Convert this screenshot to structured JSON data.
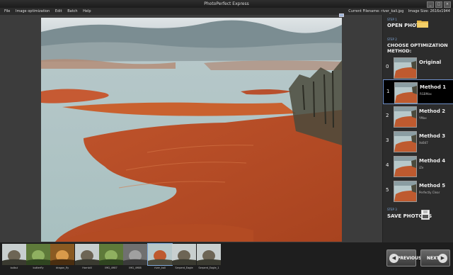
{
  "app": {
    "title": "PhotoPerfect Express",
    "window_controls": [
      "_",
      "□",
      "×"
    ]
  },
  "menu": {
    "items": [
      "File",
      "Image optimization",
      "Edit",
      "Batch",
      "Help"
    ],
    "current_filename": "Current Filename: river_kali.jpg",
    "image_size": "Image Size: 2616x1944"
  },
  "panel": {
    "step1": {
      "label": "STEP 1",
      "title": "OPEN PHOTO",
      "icon": "folder-icon"
    },
    "step2": {
      "label": "STEP 2",
      "title": "CHOOSE OPTIMIZATION METHOD:"
    },
    "methods": [
      {
        "num": "0",
        "name": "Original",
        "sub": ""
      },
      {
        "num": "1",
        "name": "Method 1",
        "sub": "RGBMax"
      },
      {
        "num": "2",
        "name": "Method 2",
        "sub": "YMax"
      },
      {
        "num": "3",
        "name": "Method 3",
        "sub": "XeB47"
      },
      {
        "num": "4",
        "name": "Method 4",
        "sub": "iZe"
      },
      {
        "num": "5",
        "name": "Method 5",
        "sub": "Perfectly Clear"
      }
    ],
    "selected_method": 1,
    "step3": {
      "label": "STEP 3",
      "title": "SAVE PHOTO AS",
      "icon": "save-icon"
    }
  },
  "filmstrip": [
    {
      "caption": "bulbul",
      "kind": "bird"
    },
    {
      "caption": "butterfly",
      "kind": "green"
    },
    {
      "caption": "dragon_fly",
      "kind": "orange"
    },
    {
      "caption": "Hornbill",
      "kind": "bird"
    },
    {
      "caption": "IMG_4987",
      "kind": "green"
    },
    {
      "caption": "IMG_4988",
      "kind": "grey"
    },
    {
      "caption": "river_kali",
      "kind": "river"
    },
    {
      "caption": "Serpent_Eagle",
      "kind": "bird"
    },
    {
      "caption": "Serpent_Eagle_1",
      "kind": "bird"
    }
  ],
  "selected_thumb": 6,
  "nav": {
    "prev": "PREVIOUS",
    "next": "NEXT",
    "prev_icon": "arrow-left-icon",
    "next_icon": "arrow-right-icon"
  },
  "colors": {
    "accent": "#7fa7d8",
    "panel_bg": "#2c2c2c",
    "selected_border": "#6f8fc8"
  }
}
